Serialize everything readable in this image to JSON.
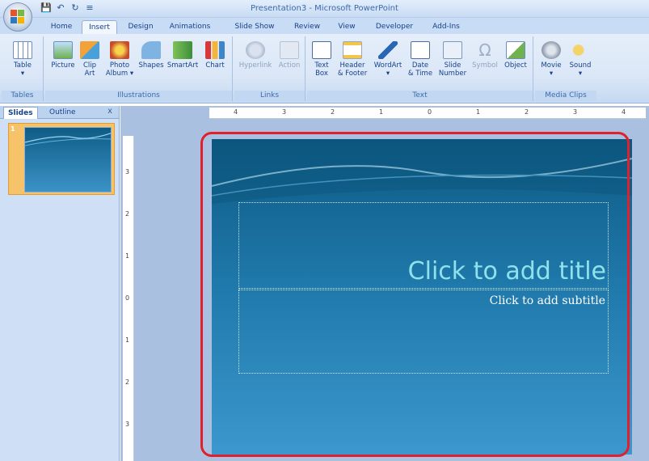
{
  "window": {
    "title": "Presentation3 - Microsoft PowerPoint"
  },
  "tabs": [
    "Home",
    "Insert",
    "Design",
    "Animations",
    "Slide Show",
    "Review",
    "View",
    "Developer",
    "Add-Ins"
  ],
  "active_tab": "Insert",
  "ribbon": {
    "groups": {
      "tables": "Tables",
      "illustrations": "Illustrations",
      "links": "Links",
      "text": "Text",
      "media": "Media Clips"
    },
    "commands": {
      "table": [
        "Table",
        "▾"
      ],
      "picture": "Picture",
      "clip_art": [
        "Clip",
        "Art"
      ],
      "photo_album": [
        "Photo",
        "Album ▾",
        "▾"
      ],
      "shapes": "Shapes",
      "smartart": "SmartArt",
      "chart": "Chart",
      "hyperlink": "Hyperlink",
      "action": "Action",
      "text_box": [
        "Text",
        "Box"
      ],
      "header_footer": [
        "Header",
        "& Footer"
      ],
      "wordart": [
        "WordArt",
        "▾"
      ],
      "date_time": [
        "Date",
        "& Time"
      ],
      "slide_number": [
        "Slide",
        "Number"
      ],
      "symbol": "Symbol",
      "object": "Object",
      "movie": [
        "Movie",
        "▾"
      ],
      "sound": [
        "Sound",
        "▾"
      ]
    }
  },
  "left_pane": {
    "tabs": [
      "Slides",
      "Outline"
    ],
    "close": "x",
    "slide_number": "1"
  },
  "rulers": {
    "horizontal": [
      "4",
      "3",
      "2",
      "1",
      "0",
      "1",
      "2",
      "3",
      "4"
    ],
    "vertical": [
      "3",
      "2",
      "1",
      "0",
      "1",
      "2",
      "3"
    ]
  },
  "slide": {
    "title_placeholder": "Click to add title",
    "subtitle_placeholder": "Click to add subtitle"
  },
  "colors": {
    "highlight": "#e0202a",
    "title_text": "#8fe1ec"
  }
}
